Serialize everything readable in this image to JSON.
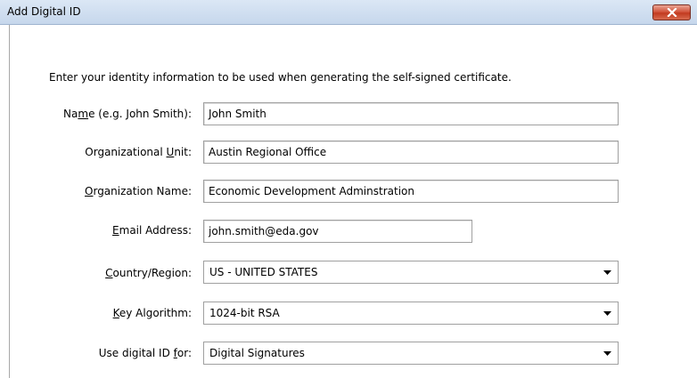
{
  "window": {
    "title": "Add Digital ID"
  },
  "intro": "Enter your identity information to be used when generating the self-signed certificate.",
  "fields": [
    {
      "label_pre": "Na",
      "label_u": "m",
      "label_post": "e (e.g. John Smith):",
      "value": "John Smith"
    },
    {
      "label_pre": "Organizational ",
      "label_u": "U",
      "label_post": "nit:",
      "value": "Austin Regional Office"
    },
    {
      "label_pre": "",
      "label_u": "O",
      "label_post": "rganization Name:",
      "value": "Economic Development Adminstration"
    },
    {
      "label_pre": "",
      "label_u": "E",
      "label_post": "mail Address:",
      "value": "john.smith@eda.gov"
    }
  ],
  "selects": [
    {
      "label_pre": "",
      "label_u": "C",
      "label_post": "ountry/Region:",
      "value": "US - UNITED STATES"
    },
    {
      "label_pre": "",
      "label_u": "K",
      "label_post": "ey Algorithm:",
      "value": "1024-bit RSA"
    },
    {
      "label_pre": "Use digital ID ",
      "label_u": "f",
      "label_post": "or:",
      "value": "Digital Signatures"
    }
  ],
  "icons": {
    "close": "close-icon",
    "dropdown": "chevron-down-icon"
  },
  "colors": {
    "titlebar": "#c6d7ec",
    "close_button": "#c23a20"
  }
}
